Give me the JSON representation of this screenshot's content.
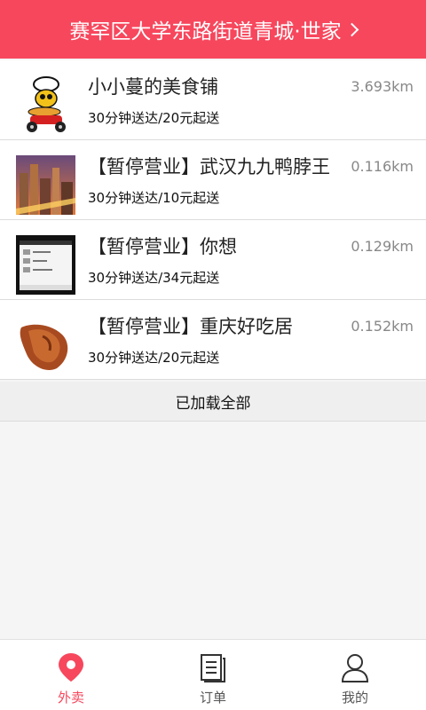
{
  "header": {
    "location": "赛罕区大学东路街道青城·世家"
  },
  "shops": [
    {
      "name": "小小蔓的美食铺",
      "distance": "3.693km",
      "delivery": "30分钟送达/20元起送",
      "thumb_icon": "chef-scooter-logo"
    },
    {
      "name": "【暂停营业】武汉九九鸭脖王",
      "distance": "0.116km",
      "delivery": "30分钟送达/10元起送",
      "thumb_icon": "city-night-photo"
    },
    {
      "name": "【暂停营业】你想",
      "distance": "0.129km",
      "delivery": "30分钟送达/34元起送",
      "thumb_icon": "phone-screenshot"
    },
    {
      "name": "【暂停营业】重庆好吃居",
      "distance": "0.152km",
      "delivery": "30分钟送达/20元起送",
      "thumb_icon": "duck-meat-photo"
    }
  ],
  "footer_status": "已加载全部",
  "tabs": [
    {
      "label": "外卖",
      "icon": "location-pin-icon",
      "active": true
    },
    {
      "label": "订单",
      "icon": "order-list-icon",
      "active": false
    },
    {
      "label": "我的",
      "icon": "user-icon",
      "active": false
    }
  ],
  "colors": {
    "accent": "#f7475d"
  }
}
